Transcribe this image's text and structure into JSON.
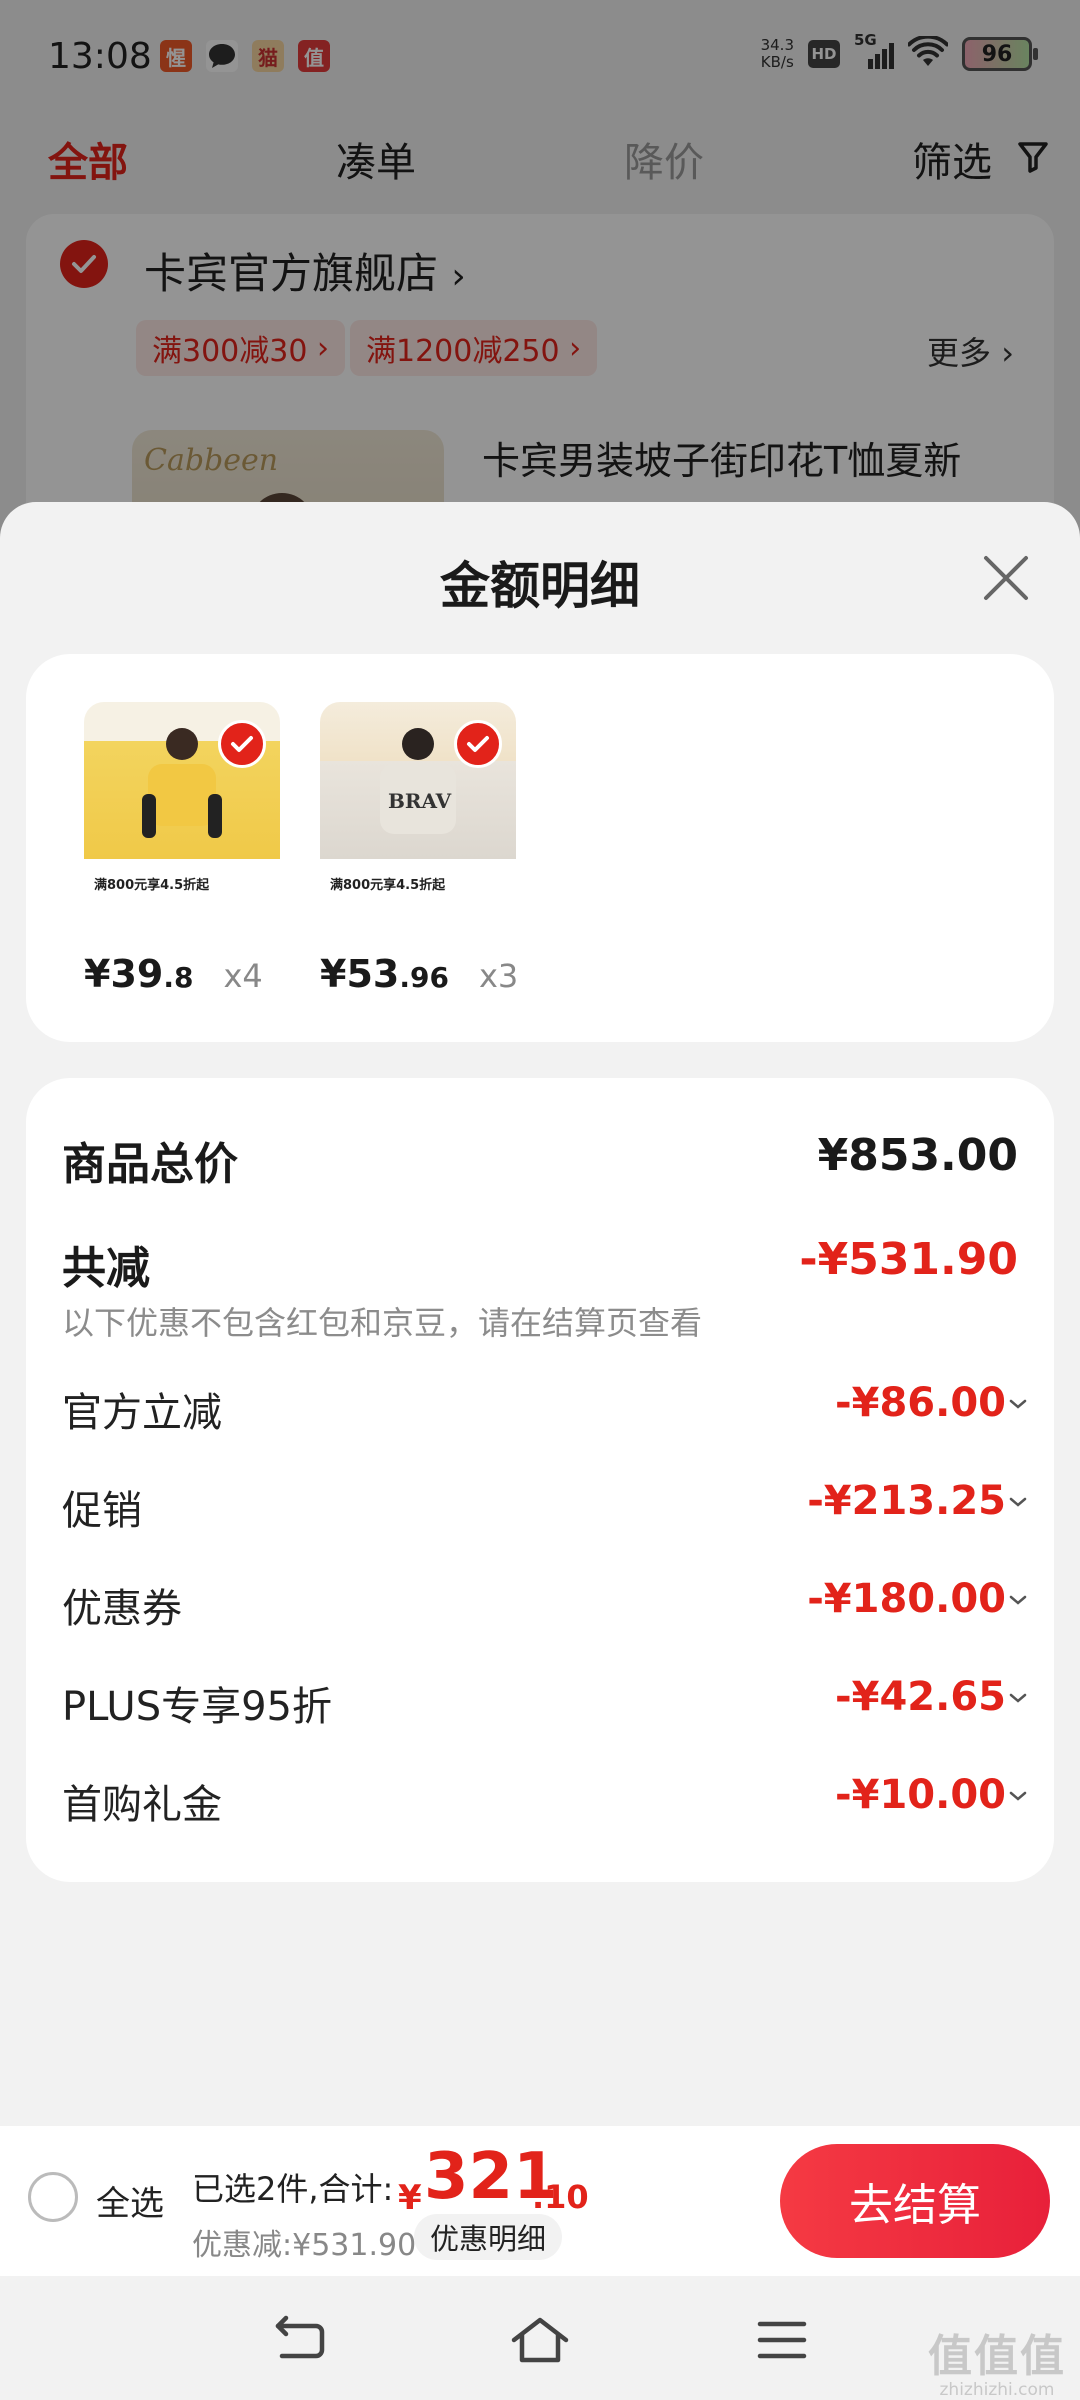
{
  "status_bar": {
    "time": "13:08",
    "network_speed_value": "34.3",
    "network_speed_unit": "KB/s",
    "hd_label": "HD",
    "signal_label": "5G",
    "battery_level": "96"
  },
  "cart": {
    "tabs": [
      "全部",
      "凑单",
      "降价",
      "筛选"
    ],
    "store_name": "卡宾官方旗舰店",
    "promotions": [
      "满300减30",
      "满1200减250"
    ],
    "more_label": "更多",
    "product_name": "卡宾男装坡子街印花T恤夏新"
  },
  "sheet": {
    "title": "金额明细",
    "items": [
      {
        "price_int": "¥39",
        "price_dec": ".8",
        "qty": "x4",
        "banner": "满800元享4.5折起"
      },
      {
        "price_int": "¥53",
        "price_dec": ".96",
        "qty": "x3",
        "banner": "满800元享4.5折起"
      }
    ],
    "total_label": "商品总价",
    "total_value": "¥853.00",
    "discount_label": "共减",
    "discount_value": "-¥531.90",
    "discount_note": "以下优惠不包含红包和京豆，请在结算页查看",
    "breakdown": [
      {
        "label": "官方立减",
        "value": "-¥86.00"
      },
      {
        "label": "促销",
        "value": "-¥213.25"
      },
      {
        "label": "优惠券",
        "value": "-¥180.00"
      },
      {
        "label": "PLUS专享95折",
        "value": "-¥42.65"
      },
      {
        "label": "首购礼金",
        "value": "-¥10.00"
      }
    ]
  },
  "bottom_bar": {
    "select_all": "全选",
    "selected_text": "已选2件,合计:",
    "total_symbol": "¥",
    "total_int": "321",
    "total_dec": ".10",
    "saved_text": "优惠减:¥531.90",
    "detail_link": "优惠明细",
    "checkout": "去结算"
  },
  "watermark": {
    "main": "值值值",
    "sub": "zhizhizhi.com"
  },
  "colors": {
    "accent": "#e2231a",
    "checkout_gradient_start": "#f53a43",
    "checkout_gradient_end": "#e8203a",
    "sheet_bg": "#f2f2f2"
  },
  "icons": {
    "close": "close-icon",
    "filter": "filter-icon",
    "check": "check-icon",
    "chevron": "chevron-down-icon",
    "nav_back": "back-icon",
    "nav_home": "home-icon",
    "nav_menu": "menu-icon"
  }
}
